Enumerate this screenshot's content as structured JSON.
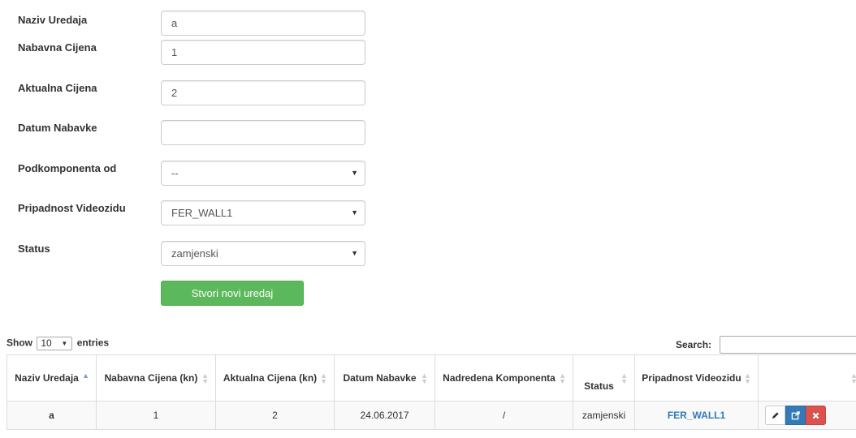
{
  "form": {
    "fields": [
      {
        "label": "Naziv Uredaja",
        "value": "a",
        "type": "text"
      },
      {
        "label": "Nabavna Cijena",
        "value": "1",
        "type": "text"
      },
      {
        "label": "Aktualna Cijena",
        "value": "2",
        "type": "text"
      },
      {
        "label": "Datum Nabavke",
        "value": "",
        "type": "text"
      },
      {
        "label": "Podkomponenta od",
        "value": "--",
        "type": "select"
      },
      {
        "label": "Pripadnost Videozidu",
        "value": "FER_WALL1",
        "type": "select"
      },
      {
        "label": "Status",
        "value": "zamjenski",
        "type": "select"
      }
    ],
    "submit_label": "Stvori novi uredaj"
  },
  "datatable": {
    "show_label": "Show",
    "entries_value": "10",
    "entries_label": "entries",
    "search_label": "Search:",
    "search_value": "",
    "columns": [
      {
        "label": "Naziv Uredaja",
        "sort": "asc"
      },
      {
        "label": "Nabavna Cijena (kn)",
        "sort": "both"
      },
      {
        "label": "Aktualna Cijena (kn)",
        "sort": "both"
      },
      {
        "label": "Datum Nabavke",
        "sort": "both"
      },
      {
        "label": "Nadredena Komponenta",
        "sort": "both"
      },
      {
        "label": "Status",
        "sort": "both"
      },
      {
        "label": "Pripadnost Videozidu",
        "sort": "both"
      },
      {
        "label": "",
        "sort": "both"
      }
    ],
    "rows": [
      {
        "naziv": "a",
        "nabavna": "1",
        "aktualna": "2",
        "datum": "24.06.2017",
        "nadredena": "/",
        "status": "zamjenski",
        "pripadnost": "FER_WALL1",
        "actions": [
          "pencil-icon",
          "open-external-icon",
          "close-icon"
        ]
      }
    ]
  },
  "colors": {
    "success": "#5cb85c",
    "primary": "#337ab7",
    "danger": "#d9534f"
  }
}
